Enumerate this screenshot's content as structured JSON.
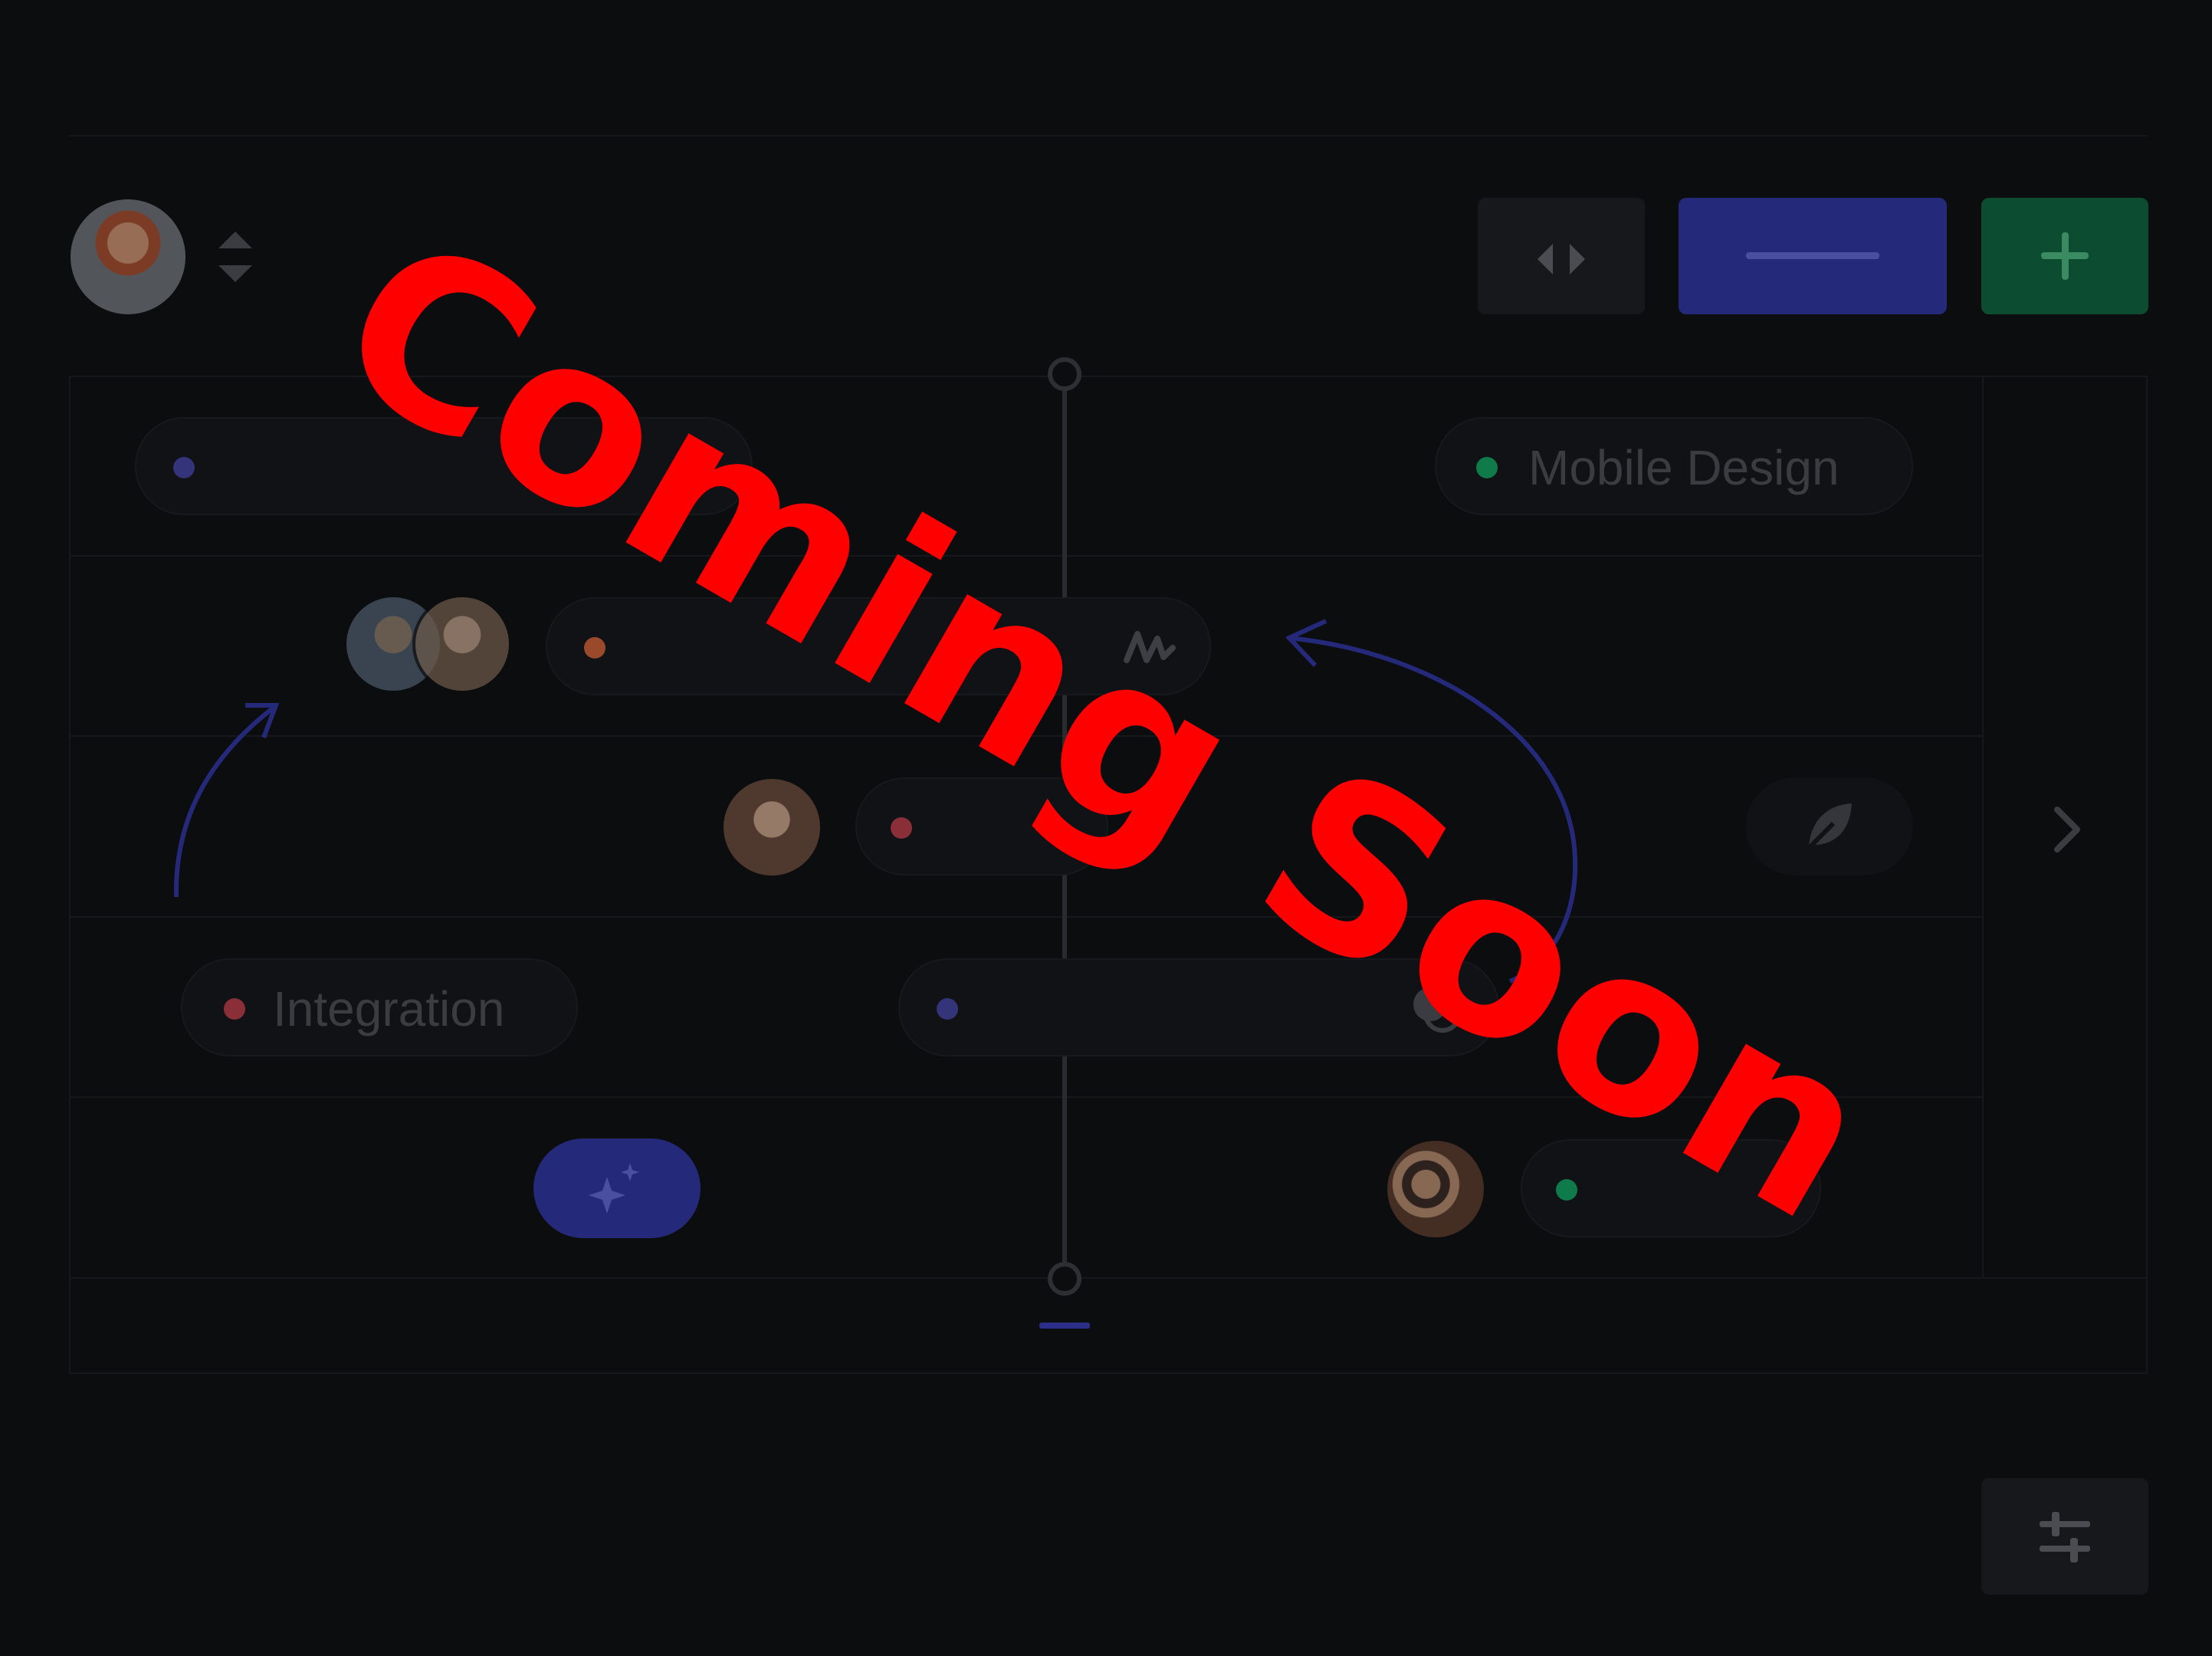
{
  "overlay": {
    "text": "Coming Soon",
    "color": "#ff0000"
  },
  "toolbar": {
    "avatar_icon": "user-avatar",
    "sort_icon": "sort-toggle-icon",
    "code_button_icon": "code-brackets-icon",
    "minus_button_icon": "minus-icon",
    "plus_button_icon": "plus-icon",
    "settings_button_icon": "sliders-icon"
  },
  "board": {
    "tasks": [
      {
        "label": "",
        "dot_color": "#33347a"
      },
      {
        "label": "Mobile Design",
        "dot_color": "#0f7a4a"
      },
      {
        "label": "",
        "dot_color": "#9a4a2a"
      },
      {
        "label": "",
        "dot_color": "#8a2f38"
      },
      {
        "label": "Integration",
        "dot_color": "#8a2f38"
      },
      {
        "label": "",
        "dot_color": "#33347a"
      },
      {
        "label": "",
        "dot_color": "#0f7a4a"
      }
    ],
    "icons": [
      "activity-icon",
      "leaf-icon",
      "toggle-icon",
      "sparkle-icon",
      "chevron-right-icon"
    ]
  },
  "colors": {
    "background": "#0c0d0f",
    "accent_blue": "#25297a",
    "accent_green": "#0c4d31",
    "overlay_red": "#ff0000"
  }
}
